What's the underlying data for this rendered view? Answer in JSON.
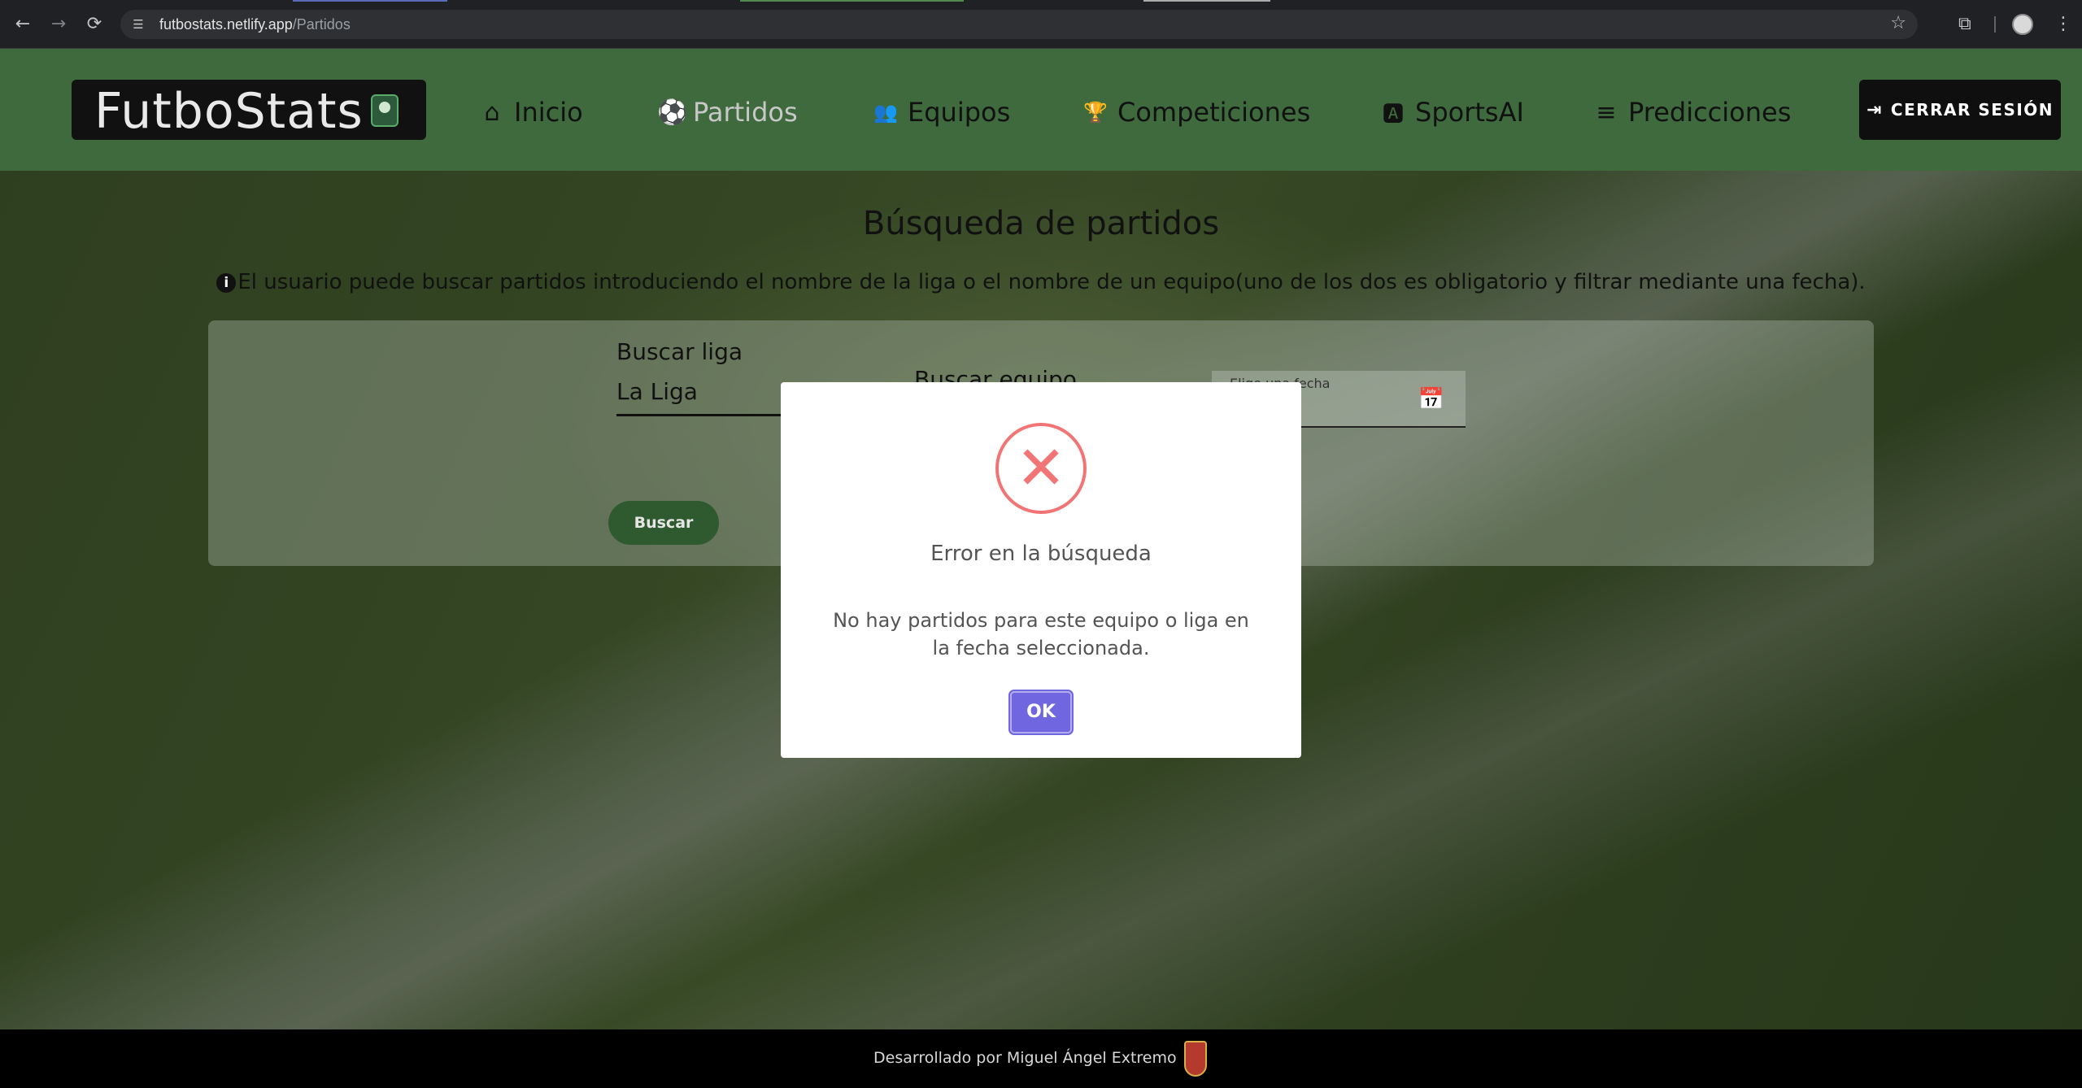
{
  "browser": {
    "url_host": "futbostats.netlify.app",
    "url_path": "/Partidos",
    "back_glyph": "←",
    "forward_glyph": "→",
    "reload_glyph": "⟳",
    "site_info_glyph": "☰",
    "star_glyph": "☆",
    "extensions_glyph": "⧉",
    "menu_glyph": "⋮"
  },
  "navbar": {
    "brand": "FutboStats",
    "items": [
      {
        "label": "Inicio",
        "icon": "home-icon",
        "glyph": "⌂"
      },
      {
        "label": "Partidos",
        "icon": "soccer-ball-icon",
        "glyph": "⚽"
      },
      {
        "label": "Equipos",
        "icon": "team-icon",
        "glyph": "👥"
      },
      {
        "label": "Competiciones",
        "icon": "trophy-icon",
        "glyph": "🏆"
      },
      {
        "label": "SportsAI",
        "icon": "ai-icon",
        "glyph": "🅰"
      },
      {
        "label": "Predicciones",
        "icon": "bars-icon",
        "glyph": "≡"
      }
    ],
    "logout_label": "CERRAR SESIÓN",
    "logout_glyph": "⇥"
  },
  "page": {
    "title": "Búsqueda de partidos",
    "info_icon": "i",
    "info": "El usuario puede buscar partidos introduciendo el nombre de la liga o el nombre de un equipo(uno de los dos es obligatorio y filtrar mediante una fecha).",
    "search": {
      "liga_label": "Buscar liga",
      "liga_value": "La Liga",
      "equipo_label": "Buscar equipo",
      "date_placeholder": "Elige una fecha",
      "calendar_glyph": "📅",
      "button": "Buscar"
    }
  },
  "modal": {
    "icon_glyph": "✕",
    "title": "Error en la búsqueda",
    "text": "No hay partidos para este equipo o liga en la fecha seleccionada.",
    "ok": "OK"
  },
  "footer": {
    "credit": "Desarrollado por Miguel Ángel Extremo"
  },
  "colors": {
    "navbar": "#3e6a3e",
    "accent_button": "#7066e0",
    "error": "#f27474",
    "buscar": "#2f5a2f"
  }
}
